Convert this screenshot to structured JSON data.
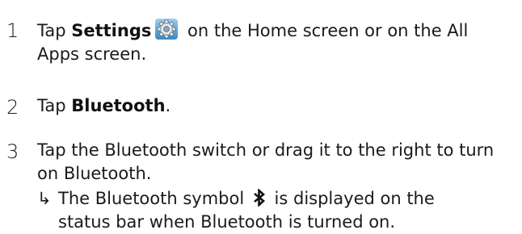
{
  "steps": [
    {
      "number": "1",
      "pre": "Tap ",
      "bold": "Settings",
      "icon": "settings-gear-icon",
      "post_line1": " on the Home screen or on the All",
      "post_line2": "Apps screen."
    },
    {
      "number": "2",
      "pre": "Tap ",
      "bold": "Bluetooth",
      "post": "."
    },
    {
      "number": "3",
      "line1": "Tap the Bluetooth switch or drag it to the right to turn",
      "line2": "on Bluetooth.",
      "result_arrow": "↳",
      "result_pre": "The Bluetooth symbol ",
      "result_icon": "bluetooth-icon",
      "result_post": " is displayed on the",
      "result_line2": "status bar when Bluetooth is turned on."
    }
  ]
}
